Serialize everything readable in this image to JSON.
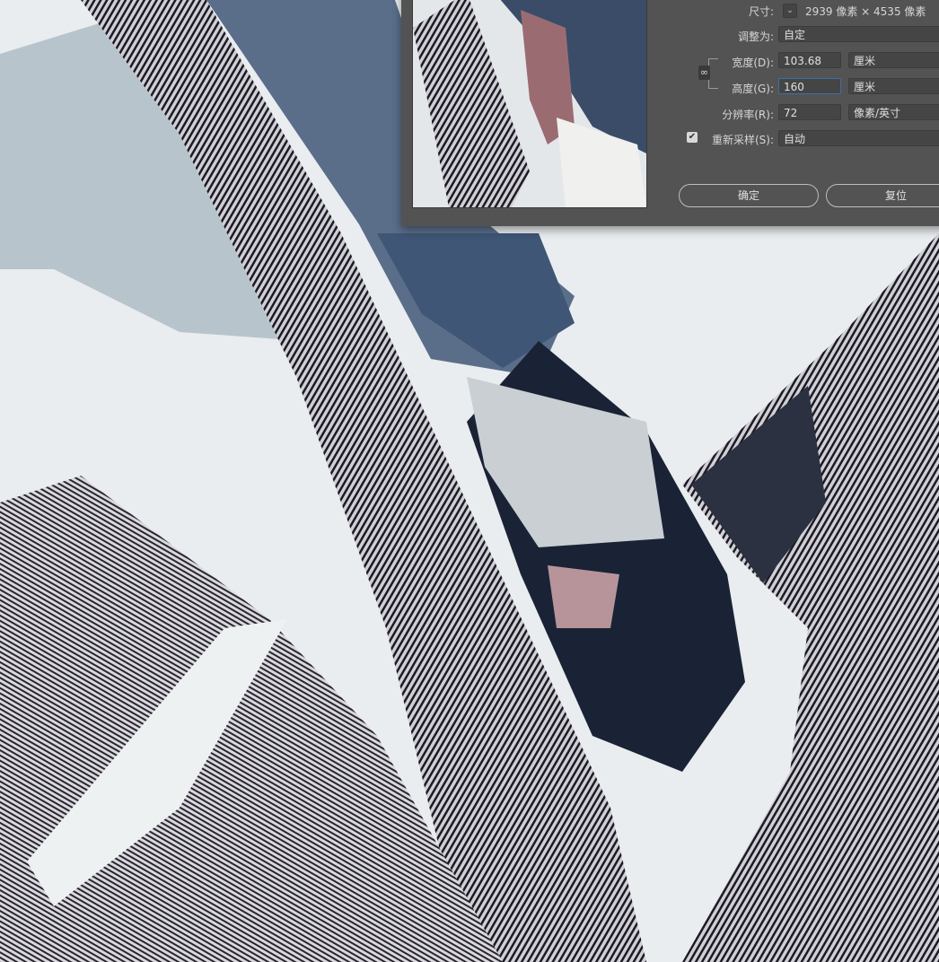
{
  "dialog": {
    "dimensions_label": "尺寸:",
    "dimensions_value": "2939 像素 × 4535 像素",
    "fit_to_label": "调整为:",
    "fit_to_value": "自定",
    "width_label": "宽度(D):",
    "width_value": "103.68",
    "width_unit": "厘米",
    "height_label": "高度(G):",
    "height_value": "160",
    "height_unit": "厘米",
    "resolution_label": "分辨率(R):",
    "resolution_value": "72",
    "resolution_unit": "像素/英寸",
    "resample_label": "重新采样(S):",
    "resample_checked": true,
    "resample_value": "自动",
    "ok_label": "确定",
    "reset_label": "复位"
  }
}
